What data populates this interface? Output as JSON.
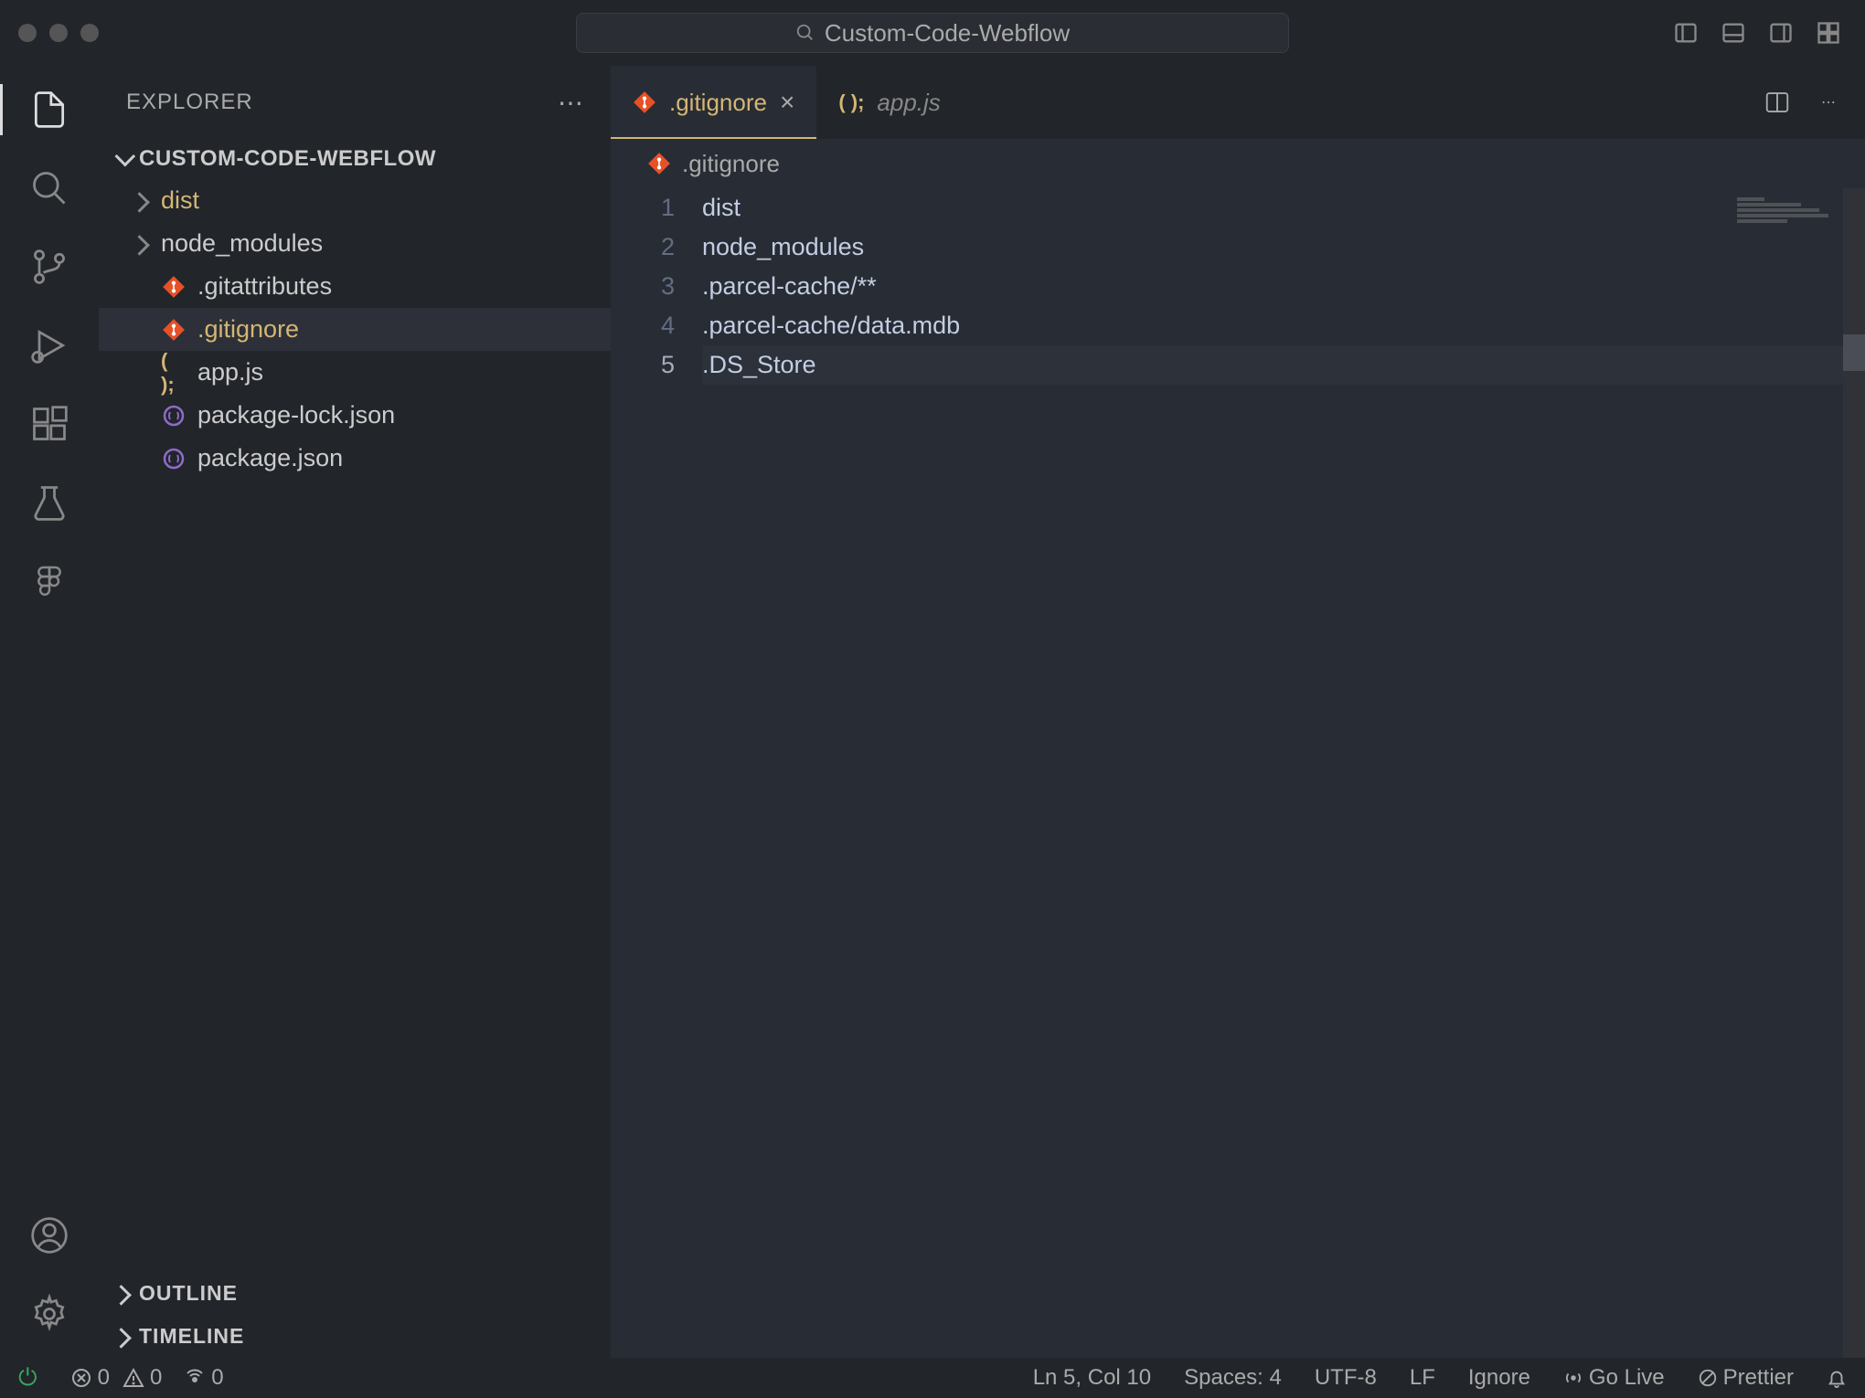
{
  "titlebar": {
    "search_text": "Custom-Code-Webflow"
  },
  "sidebar": {
    "title": "EXPLORER",
    "folder_name": "CUSTOM-CODE-WEBFLOW",
    "tree": [
      {
        "name": "dist",
        "type": "folder",
        "modified": true
      },
      {
        "name": "node_modules",
        "type": "folder"
      },
      {
        "name": ".gitattributes",
        "type": "file",
        "icon": "git"
      },
      {
        "name": ".gitignore",
        "type": "file",
        "icon": "git",
        "selected": true,
        "modified": true
      },
      {
        "name": "app.js",
        "type": "file",
        "icon": "js"
      },
      {
        "name": "package-lock.json",
        "type": "file",
        "icon": "json"
      },
      {
        "name": "package.json",
        "type": "file",
        "icon": "json"
      }
    ],
    "outline_label": "OUTLINE",
    "timeline_label": "TIMELINE"
  },
  "tabs": [
    {
      "name": ".gitignore",
      "icon": "git",
      "active": true,
      "modified": true
    },
    {
      "name": "app.js",
      "icon": "js",
      "active": false,
      "italic": true
    }
  ],
  "breadcrumb": {
    "file": ".gitignore"
  },
  "editor": {
    "lines": [
      "dist",
      "node_modules",
      ".parcel-cache/**",
      ".parcel-cache/data.mdb",
      ".DS_Store"
    ],
    "current_line": 5
  },
  "status": {
    "errors": "0",
    "warnings": "0",
    "ports": "0",
    "position": "Ln 5, Col 10",
    "spaces": "Spaces: 4",
    "encoding": "UTF-8",
    "eol": "LF",
    "language": "Ignore",
    "golive": "Go Live",
    "prettier": "Prettier"
  }
}
